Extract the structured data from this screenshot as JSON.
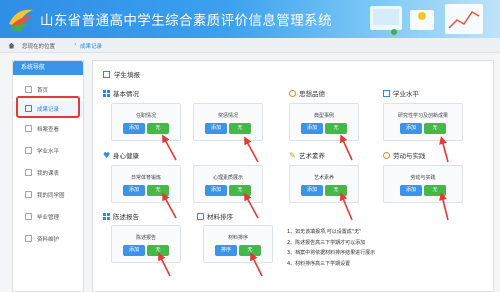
{
  "header": {
    "title": "山东省普通高中学生综合素质评价信息管理系统"
  },
  "breadcrumb": {
    "prefix": "您现在的位置",
    "separator": "›",
    "current": "成果记录"
  },
  "sidebar": {
    "title": "系统导航",
    "items": [
      {
        "label": "首页"
      },
      {
        "label": "成果记录"
      },
      {
        "label": "档案查看"
      },
      {
        "label": "学业水平"
      },
      {
        "label": "我的课表"
      },
      {
        "label": "我的同学圈"
      },
      {
        "label": "毕业管理"
      },
      {
        "label": "资料维护"
      }
    ]
  },
  "main": {
    "title": "学生填报",
    "sections": {
      "basic": "基本情况",
      "moral": "思想品德",
      "academic": "学业水平",
      "health": "身心健康",
      "art": "艺术素养",
      "labor": "劳动与实践",
      "report": "陈述报告",
      "material": "材料排序"
    },
    "cards": [
      {
        "label": "任职情况",
        "add": "添加",
        "none": "无"
      },
      {
        "label": "奖惩情况",
        "add": "添加",
        "none": "无"
      },
      {
        "label": "典型事例",
        "add": "添加",
        "none": "无"
      },
      {
        "label": "研究性学习及创新成果",
        "add": "添加",
        "none": "无"
      },
      {
        "label": "日常体育锻炼",
        "add": "添加",
        "none": "无"
      },
      {
        "label": "心理素质展示",
        "add": "添加",
        "none": "无"
      },
      {
        "label": "艺术素养",
        "add": "添加",
        "none": "无"
      },
      {
        "label": "劳动与实践",
        "add": "添加",
        "none": "无"
      },
      {
        "label": "陈述报告",
        "add": "添加",
        "none": "无"
      },
      {
        "label": "材料排序",
        "add": "排序",
        "none": "无"
      }
    ],
    "notes": [
      "1、如无该填报项,可以设置成\"无\"",
      "2、陈述报告高三下学期才可以添加",
      "3、档案中将依据材料排序结果进行展示",
      "4、材料排序高三下学期设置"
    ]
  },
  "colors": {
    "header": "#2f8ee6",
    "primary": "#3b94e8",
    "success": "#46b84a",
    "highlight": "#e53935"
  }
}
